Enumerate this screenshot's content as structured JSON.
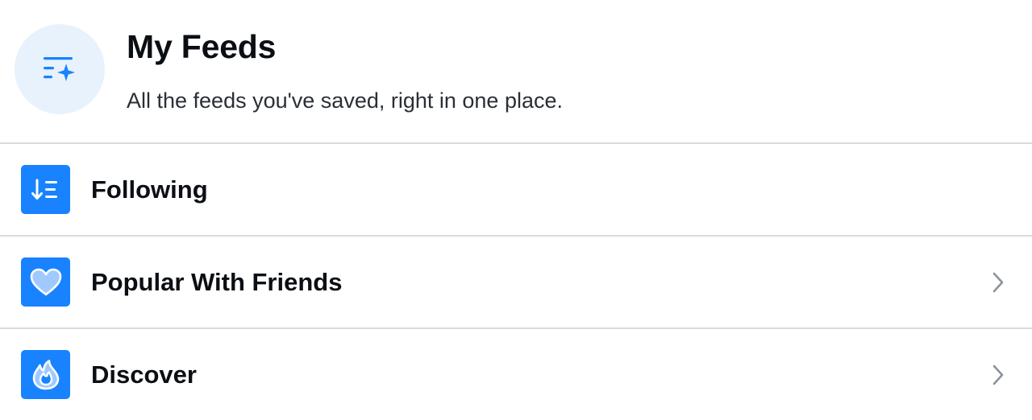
{
  "header": {
    "icon": "feeds-sparkle-icon",
    "title": "My Feeds",
    "subtitle": "All the feeds you've saved, right in one place."
  },
  "feeds": [
    {
      "label": "Following",
      "icon": "following-sort-icon",
      "has_chevron": false
    },
    {
      "label": "Popular With Friends",
      "icon": "heart-icon",
      "has_chevron": true
    },
    {
      "label": "Discover",
      "icon": "flame-icon",
      "has_chevron": true
    }
  ],
  "colors": {
    "accent": "#1983ff",
    "icon_circle_bg": "#e8f2fd",
    "divider": "#d6dbe0",
    "chevron": "#8a929b"
  }
}
